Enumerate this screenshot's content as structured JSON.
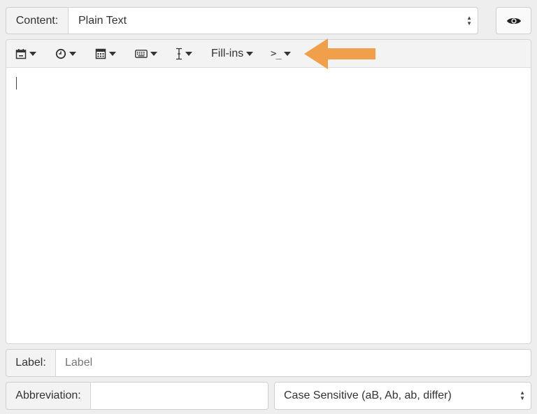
{
  "content_row": {
    "label": "Content:",
    "select_value": "Plain Text"
  },
  "preview_button": {
    "icon": "eye-icon"
  },
  "toolbar": {
    "items": [
      {
        "icon": "calendar-icon"
      },
      {
        "icon": "clock-icon"
      },
      {
        "icon": "calculator-icon"
      },
      {
        "icon": "keyboard-icon"
      },
      {
        "icon": "text-cursor-icon"
      },
      {
        "label": "Fill-ins"
      },
      {
        "icon": "terminal-icon",
        "label": ">_"
      }
    ]
  },
  "annotation": {
    "icon": "arrow-left-icon",
    "color": "#F0A04B"
  },
  "editor": {
    "text": ""
  },
  "label_row": {
    "label": "Label:",
    "placeholder": "Label"
  },
  "abbreviation_row": {
    "label": "Abbreviation:",
    "value": "",
    "case_select_value": "Case Sensitive (aB, Ab, ab, differ)"
  }
}
